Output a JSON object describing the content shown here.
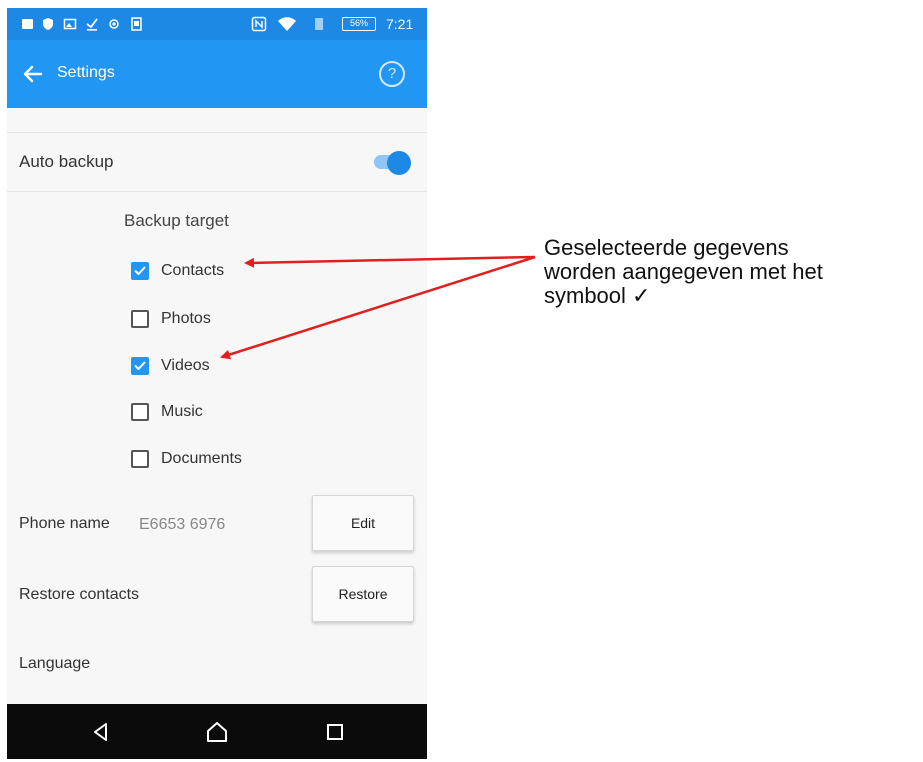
{
  "status_bar": {
    "battery": "56%",
    "time": "7:21",
    "icons": [
      "notification-icon",
      "shield-icon",
      "image-icon",
      "download-icon",
      "record-icon",
      "sd-card-icon",
      "nfc-icon",
      "wifi-icon",
      "sim-icon"
    ]
  },
  "app_bar": {
    "title": "Settings",
    "help": "?"
  },
  "auto_backup": {
    "label": "Auto backup",
    "enabled": true
  },
  "backup_target": {
    "title": "Backup target",
    "items": [
      {
        "label": "Contacts",
        "checked": true
      },
      {
        "label": "Photos",
        "checked": false
      },
      {
        "label": "Videos",
        "checked": true
      },
      {
        "label": "Music",
        "checked": false
      },
      {
        "label": "Documents",
        "checked": false
      }
    ]
  },
  "phone_name": {
    "label": "Phone name",
    "value": "E6653 6976",
    "button": "Edit"
  },
  "restore_contacts": {
    "label": "Restore contacts",
    "button": "Restore"
  },
  "language": {
    "label": "Language"
  },
  "nav_bar": {
    "icons": [
      "back-icon",
      "home-icon",
      "recents-icon"
    ]
  },
  "annotation": {
    "line1": "Geselecteerde gegevens",
    "line2": "worden aangegeven met het",
    "line3": "symbool ✓",
    "color": "#e02020"
  },
  "colors": {
    "accent": "#2196f3",
    "status_bar": "#1e88e5",
    "nav_bar": "#0b0b0b"
  }
}
